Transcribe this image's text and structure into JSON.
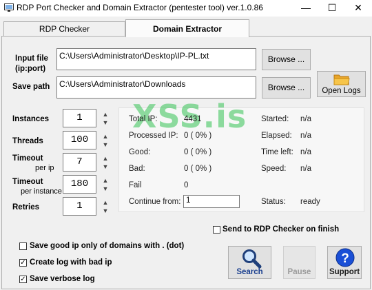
{
  "window": {
    "title": "RDP Port Checker and Domain Extractor (pentester tool) ver.1.0.86",
    "minimize_glyph": "—",
    "maximize_glyph": "☐",
    "close_glyph": "✕"
  },
  "tabs": [
    {
      "label": "RDP Checker",
      "active": false
    },
    {
      "label": "Domain Extractor",
      "active": true
    }
  ],
  "input_file": {
    "label": "Input file",
    "sublabel": "(ip:port)",
    "value": "C:\\Users\\Administrator\\Desktop\\IP-PL.txt",
    "browse": "Browse ..."
  },
  "save_path": {
    "label": "Save path",
    "value": "C:\\Users\\Administrator\\Downloads",
    "browse": "Browse ..."
  },
  "open_logs": {
    "label": "Open Logs",
    "icon": "folder-icon"
  },
  "settings": {
    "instances": {
      "label": "Instances",
      "value": "1"
    },
    "threads": {
      "label": "Threads",
      "value": "100"
    },
    "timeout_ip": {
      "label": "Timeout",
      "sublabel": "per ip",
      "value": "7"
    },
    "timeout_instance": {
      "label": "Timeout",
      "sublabel": "per instance",
      "value": "180"
    },
    "retries": {
      "label": "Retries",
      "value": "1"
    }
  },
  "watermark": "XSS.is",
  "stats": {
    "total_ip": {
      "label": "Total IP:",
      "value": "4431"
    },
    "processed_ip": {
      "label": "Processed IP:",
      "value": "0 ( 0% )"
    },
    "good": {
      "label": "Good:",
      "value": "0 ( 0% )"
    },
    "bad": {
      "label": "Bad:",
      "value": "0 ( 0% )"
    },
    "fail": {
      "label": "Fail",
      "value": "0"
    },
    "continue_from": {
      "label": "Continue from:",
      "value": "1"
    },
    "started": {
      "label": "Started:",
      "value": "n/a"
    },
    "elapsed": {
      "label": "Elapsed:",
      "value": "n/a"
    },
    "time_left": {
      "label": "Time left:",
      "value": "n/a"
    },
    "speed": {
      "label": "Speed:",
      "value": "n/a"
    },
    "status": {
      "label": "Status:",
      "value": "ready"
    }
  },
  "options": {
    "send_to_rdp": {
      "label": "Send to RDP Checker on finish",
      "checked": false
    },
    "save_good_ip": {
      "label": "Save good ip only of domains with . (dot)",
      "checked": false
    },
    "create_log_bad": {
      "label": "Create log with bad ip",
      "checked": true
    },
    "save_verbose": {
      "label": "Save verbose log",
      "checked": true
    }
  },
  "actions": {
    "search": {
      "label": "Search",
      "icon": "magnifier-icon"
    },
    "pause": {
      "label": "Pause",
      "enabled": false
    },
    "support": {
      "label": "Support",
      "icon": "question-icon",
      "color": "#1a4fd6"
    }
  },
  "spin_up": "▲",
  "spin_down": "▼",
  "check_mark": "✓"
}
